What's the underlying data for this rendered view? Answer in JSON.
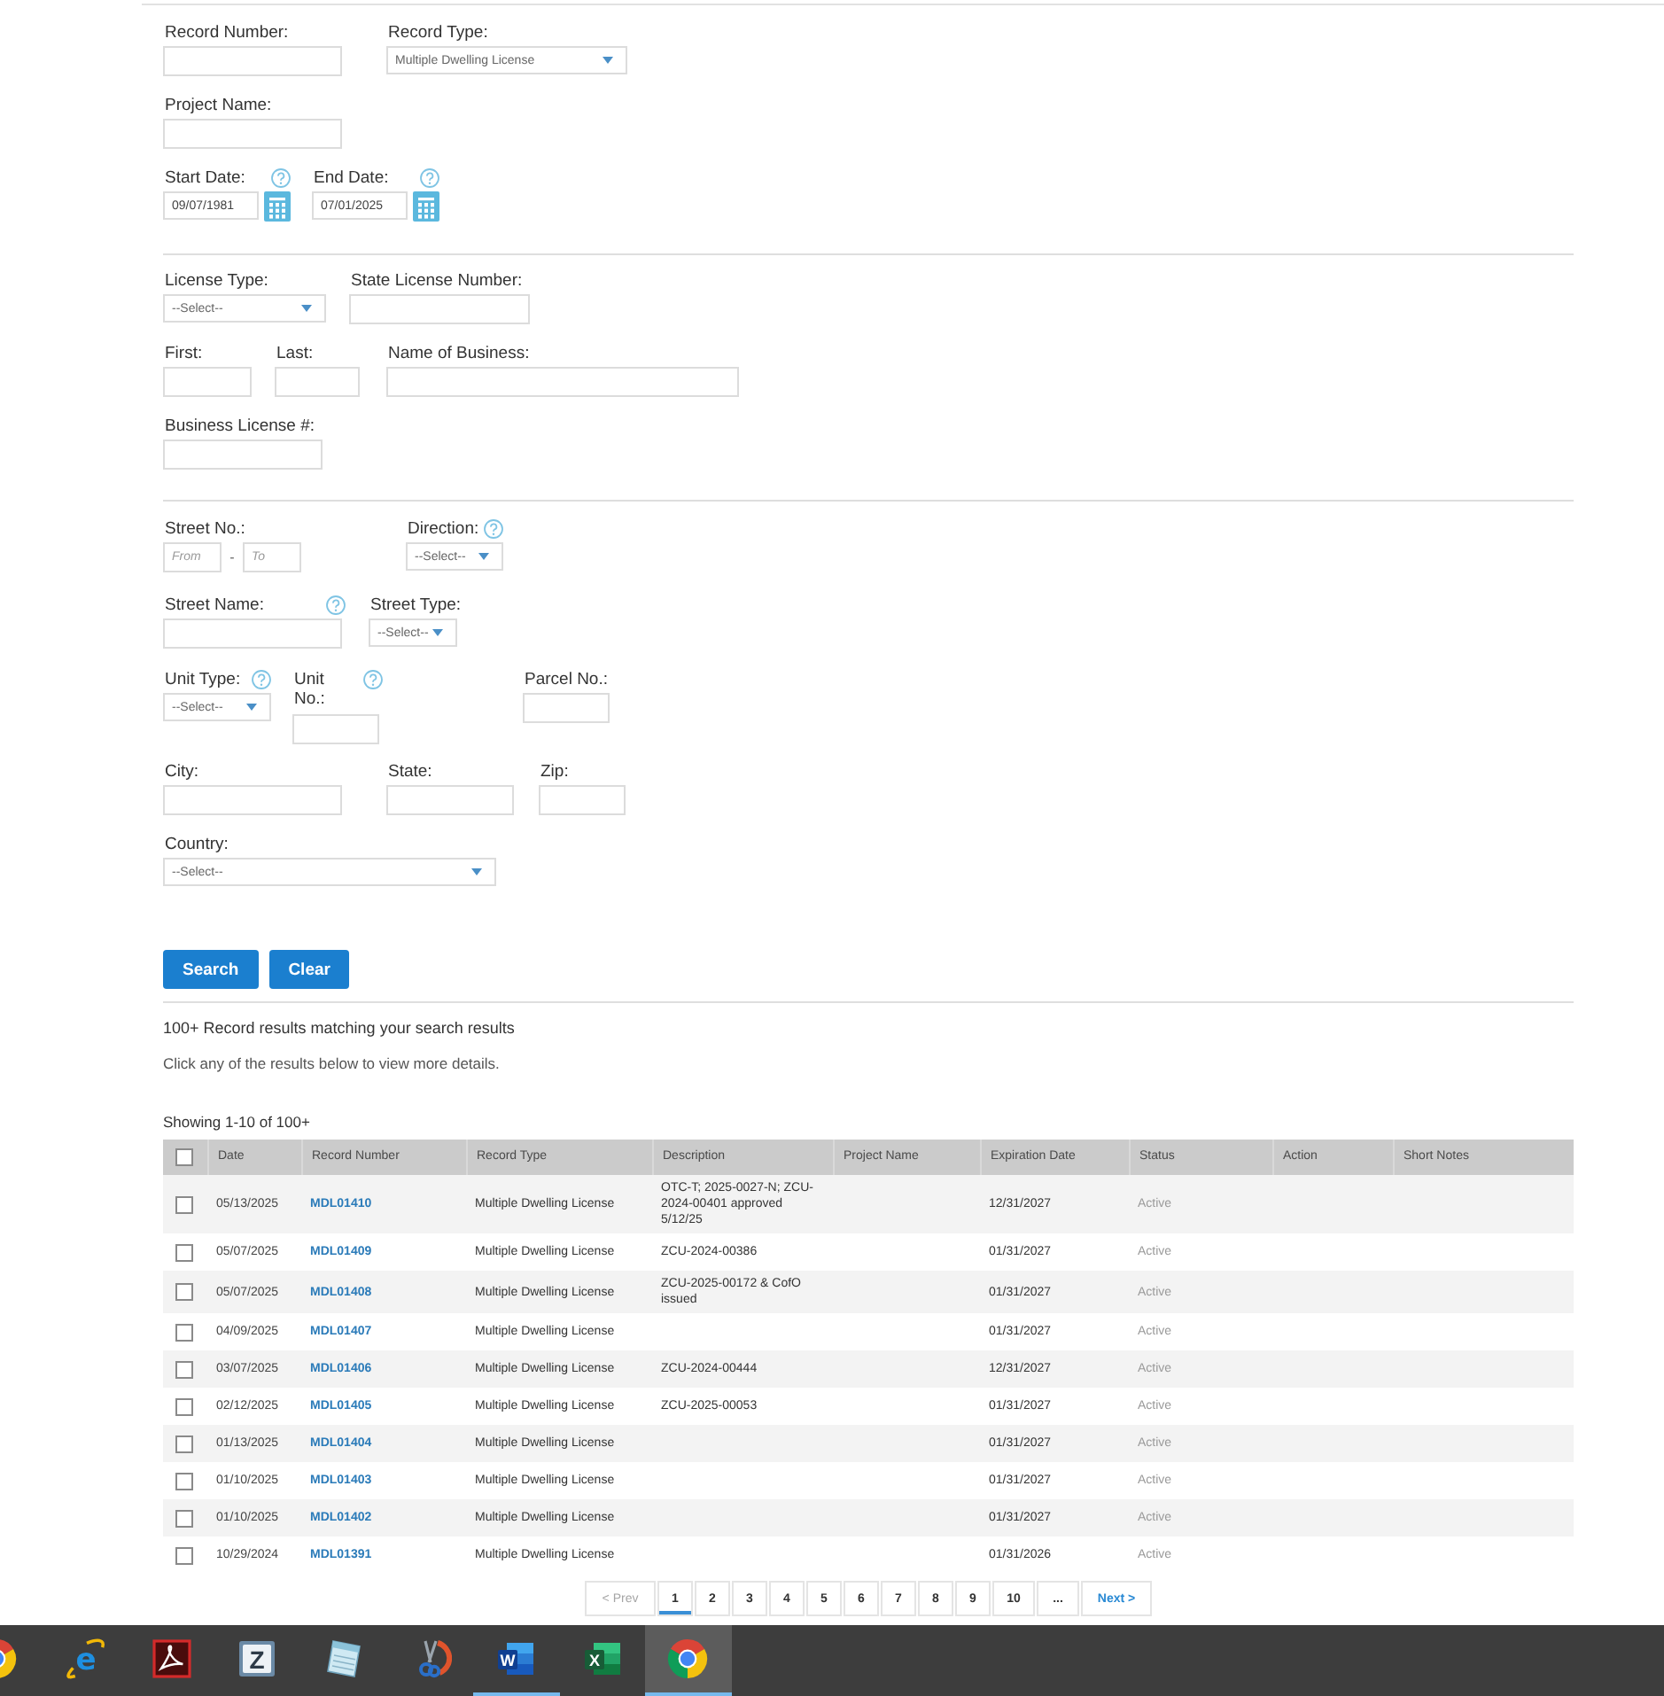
{
  "search_form": {
    "record_number": {
      "label": "Record Number:"
    },
    "record_type": {
      "label": "Record Type:",
      "value": "Multiple Dwelling License"
    },
    "project_name": {
      "label": "Project Name:"
    },
    "start_date": {
      "label": "Start Date:",
      "help": true,
      "value": "09/07/1981"
    },
    "end_date": {
      "label": "End Date:",
      "help": true,
      "value": "07/01/2025"
    },
    "license_type": {
      "label": "License Type:",
      "value": "--Select--"
    },
    "state_license_number": {
      "label": "State License Number:"
    },
    "first": {
      "label": "First:"
    },
    "last": {
      "label": "Last:"
    },
    "name_of_business": {
      "label": "Name of Business:"
    },
    "business_license": {
      "label": "Business License #:"
    },
    "street_no": {
      "label": "Street No.:",
      "from": {
        "placeholder": "From"
      },
      "separator": "-",
      "to": {
        "placeholder": "To"
      }
    },
    "direction": {
      "label": "Direction:",
      "help": true,
      "value": "--Select--"
    },
    "street_name": {
      "label": "Street Name:",
      "help": true
    },
    "street_type": {
      "label": "Street Type:",
      "value": "--Select--"
    },
    "unit_type": {
      "label": "Unit Type:",
      "help": true,
      "value": "--Select--"
    },
    "unit_no": {
      "label": "Unit No.:",
      "help": true
    },
    "parcel_no": {
      "label": "Parcel No.:"
    },
    "city": {
      "label": "City:"
    },
    "state": {
      "label": "State:"
    },
    "zip": {
      "label": "Zip:"
    },
    "country": {
      "label": "Country:",
      "value": "--Select--"
    },
    "buttons": [
      {
        "label": "Search"
      },
      {
        "label": "Clear"
      }
    ]
  },
  "results": {
    "summary": "100+ Record results matching your search results",
    "hint": "Click any of the results below to view more details.",
    "showing": "Showing 1-10 of 100+",
    "table": {
      "select_all": {
        "checked": false
      },
      "columns": [
        "Date",
        "Record Number",
        "Record Type",
        "Description",
        "Project Name",
        "Expiration Date",
        "Status",
        "Action",
        "Short Notes"
      ],
      "rows": [
        {
          "checked": false,
          "date": "05/13/2025",
          "record_number": "MDL01410",
          "record_type": "Multiple Dwelling License",
          "description": "OTC-T; 2025-0027-N; ZCU-2024-00401 approved 5/12/25",
          "expiration_date": "12/31/2027",
          "status": "Active"
        },
        {
          "checked": false,
          "date": "05/07/2025",
          "record_number": "MDL01409",
          "record_type": "Multiple Dwelling License",
          "description": "ZCU-2024-00386",
          "expiration_date": "01/31/2027",
          "status": "Active"
        },
        {
          "checked": false,
          "date": "05/07/2025",
          "record_number": "MDL01408",
          "record_type": "Multiple Dwelling License",
          "description": "ZCU-2025-00172 & CofO issued",
          "expiration_date": "01/31/2027",
          "status": "Active"
        },
        {
          "checked": false,
          "date": "04/09/2025",
          "record_number": "MDL01407",
          "record_type": "Multiple Dwelling License",
          "expiration_date": "01/31/2027",
          "status": "Active"
        },
        {
          "checked": false,
          "date": "03/07/2025",
          "record_number": "MDL01406",
          "record_type": "Multiple Dwelling License",
          "description": "ZCU-2024-00444",
          "expiration_date": "12/31/2027",
          "status": "Active"
        },
        {
          "checked": false,
          "date": "02/12/2025",
          "record_number": "MDL01405",
          "record_type": "Multiple Dwelling License",
          "description": "ZCU-2025-00053",
          "expiration_date": "01/31/2027",
          "status": "Active"
        },
        {
          "checked": false,
          "date": "01/13/2025",
          "record_number": "MDL01404",
          "record_type": "Multiple Dwelling License",
          "expiration_date": "01/31/2027",
          "status": "Active"
        },
        {
          "checked": false,
          "date": "01/10/2025",
          "record_number": "MDL01403",
          "record_type": "Multiple Dwelling License",
          "expiration_date": "01/31/2027",
          "status": "Active"
        },
        {
          "checked": false,
          "date": "01/10/2025",
          "record_number": "MDL01402",
          "record_type": "Multiple Dwelling License",
          "expiration_date": "01/31/2027",
          "status": "Active"
        },
        {
          "checked": false,
          "date": "10/29/2024",
          "record_number": "MDL01391",
          "record_type": "Multiple Dwelling License",
          "expiration_date": "01/31/2026",
          "status": "Active"
        }
      ]
    }
  },
  "pagination": {
    "prev": "< Prev",
    "pages": [
      {
        "label": "1",
        "selected": true
      },
      {
        "label": "2",
        "selected": false
      },
      {
        "label": "3",
        "selected": false
      },
      {
        "label": "4",
        "selected": false
      },
      {
        "label": "5",
        "selected": false
      },
      {
        "label": "6",
        "selected": false
      },
      {
        "label": "7",
        "selected": false
      },
      {
        "label": "8",
        "selected": false
      },
      {
        "label": "9",
        "selected": false
      },
      {
        "label": "10",
        "selected": false
      },
      {
        "label": "...",
        "selected": false
      }
    ],
    "next": "Next >"
  },
  "taskbar": {
    "items": [
      {
        "kind": "ring",
        "running": false,
        "selected": false
      },
      {
        "kind": "orbit-letter",
        "letter": "e",
        "running": false,
        "selected": false
      },
      {
        "kind": "swirl-tile",
        "running": false,
        "selected": false
      },
      {
        "kind": "letter-tile",
        "letter": "Z",
        "running": false,
        "selected": false
      },
      {
        "kind": "notepad",
        "running": false,
        "selected": false
      },
      {
        "kind": "scissors",
        "running": false,
        "selected": false
      },
      {
        "kind": "blue-tile",
        "letter": "W",
        "running": true,
        "selected": false
      },
      {
        "kind": "green-tile",
        "letter": "X",
        "running": false,
        "selected": false
      },
      {
        "kind": "ring",
        "running": true,
        "selected": true
      }
    ]
  }
}
